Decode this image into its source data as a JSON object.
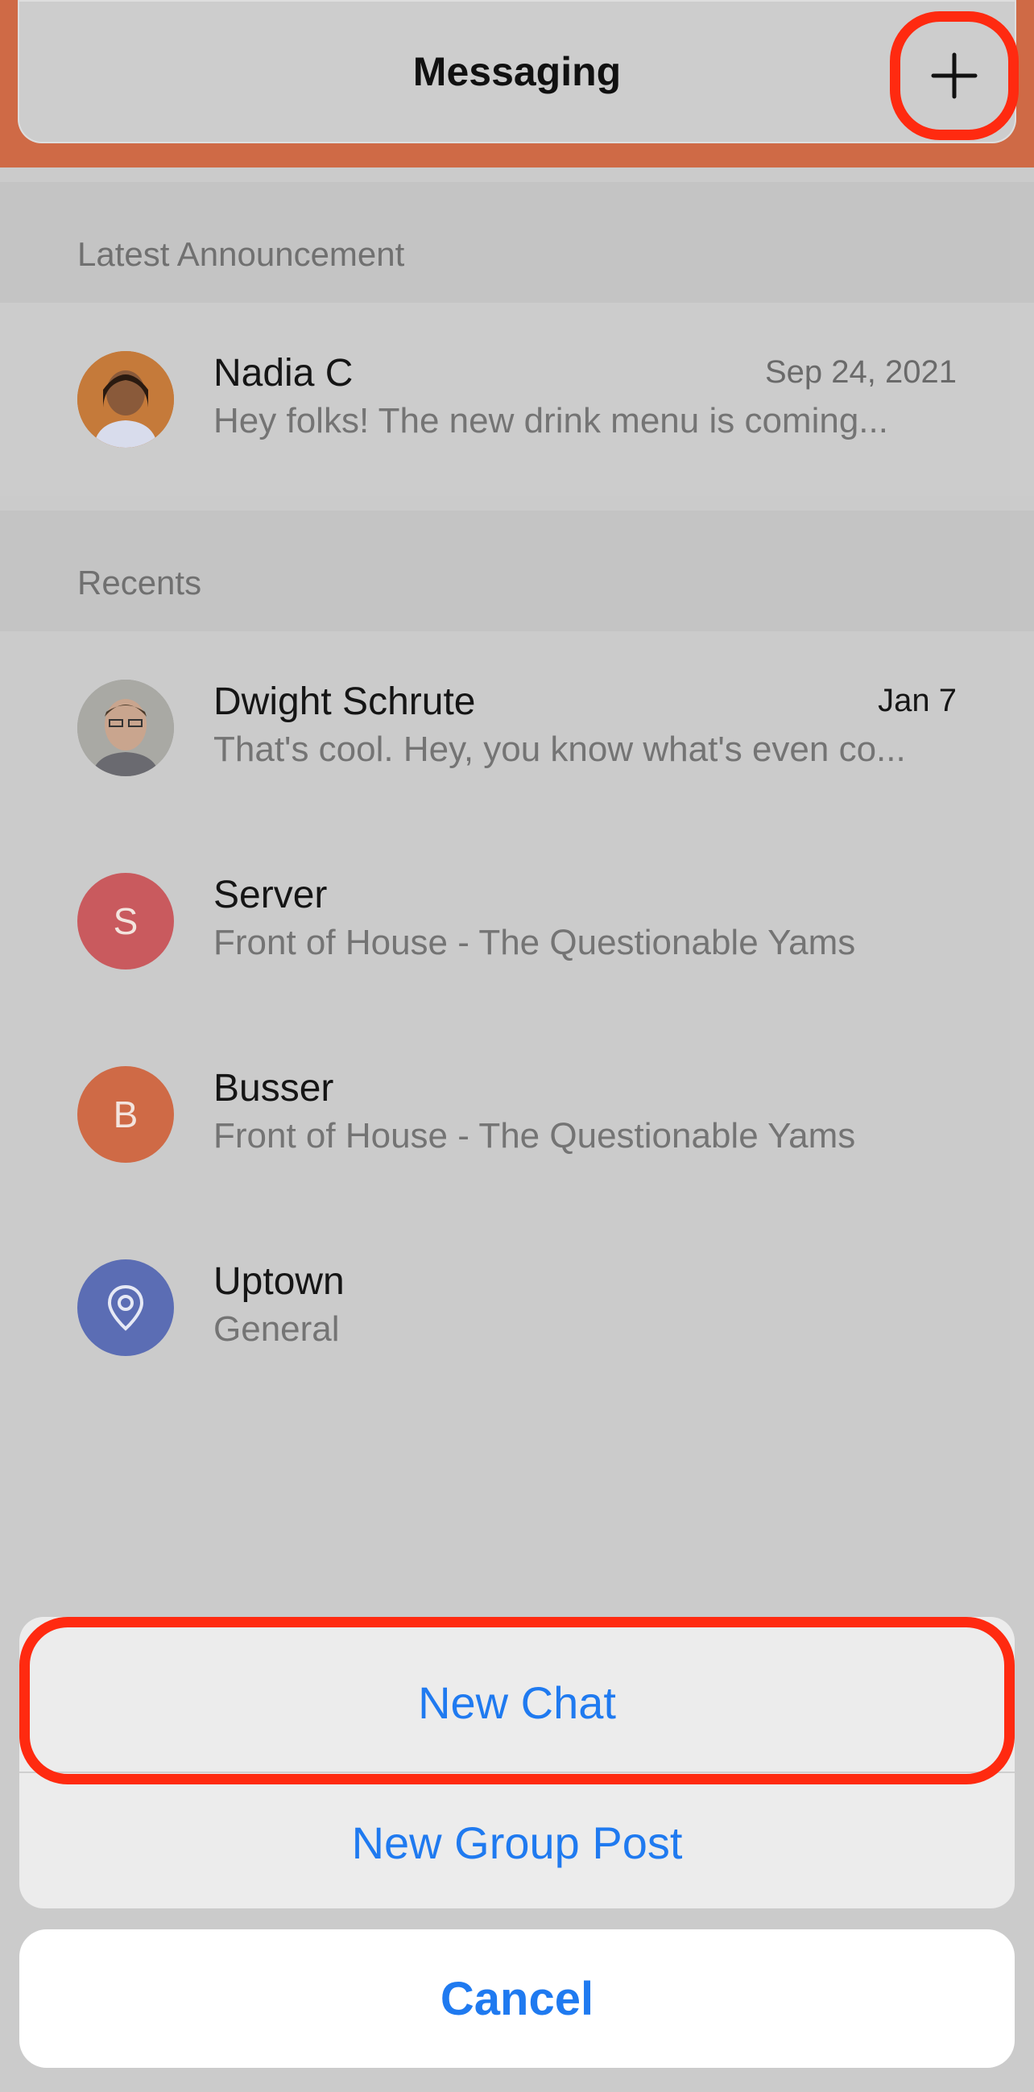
{
  "header": {
    "title": "Messaging",
    "add_icon": "plus-icon"
  },
  "announcement_section": {
    "label": "Latest Announcement",
    "item": {
      "name": "Nadia C",
      "date": "Sep 24, 2021",
      "preview": "Hey folks! The new drink menu is coming..."
    }
  },
  "recents_section": {
    "label": "Recents",
    "items": [
      {
        "name": "Dwight Schrute",
        "date": "Jan 7",
        "preview": "That's cool. Hey, you know what's even co...",
        "avatar": "photo"
      },
      {
        "name": "Server",
        "date": "",
        "preview": "Front of House - The Questionable Yams",
        "avatar_letter": "S",
        "avatar_color": "#c95a5e"
      },
      {
        "name": "Busser",
        "date": "",
        "preview": "Front of House - The Questionable Yams",
        "avatar_letter": "B",
        "avatar_color": "#cf6a46"
      },
      {
        "name": "Uptown",
        "date": "",
        "preview": "General",
        "avatar_icon": "location-pin-icon",
        "avatar_color": "#5b6db4"
      }
    ]
  },
  "action_sheet": {
    "new_chat": "New Chat",
    "new_group_post": "New Group Post",
    "cancel": "Cancel"
  },
  "colors": {
    "accent": "#1f7af0",
    "highlight": "#ff2a10",
    "brand": "#cf6a46"
  }
}
